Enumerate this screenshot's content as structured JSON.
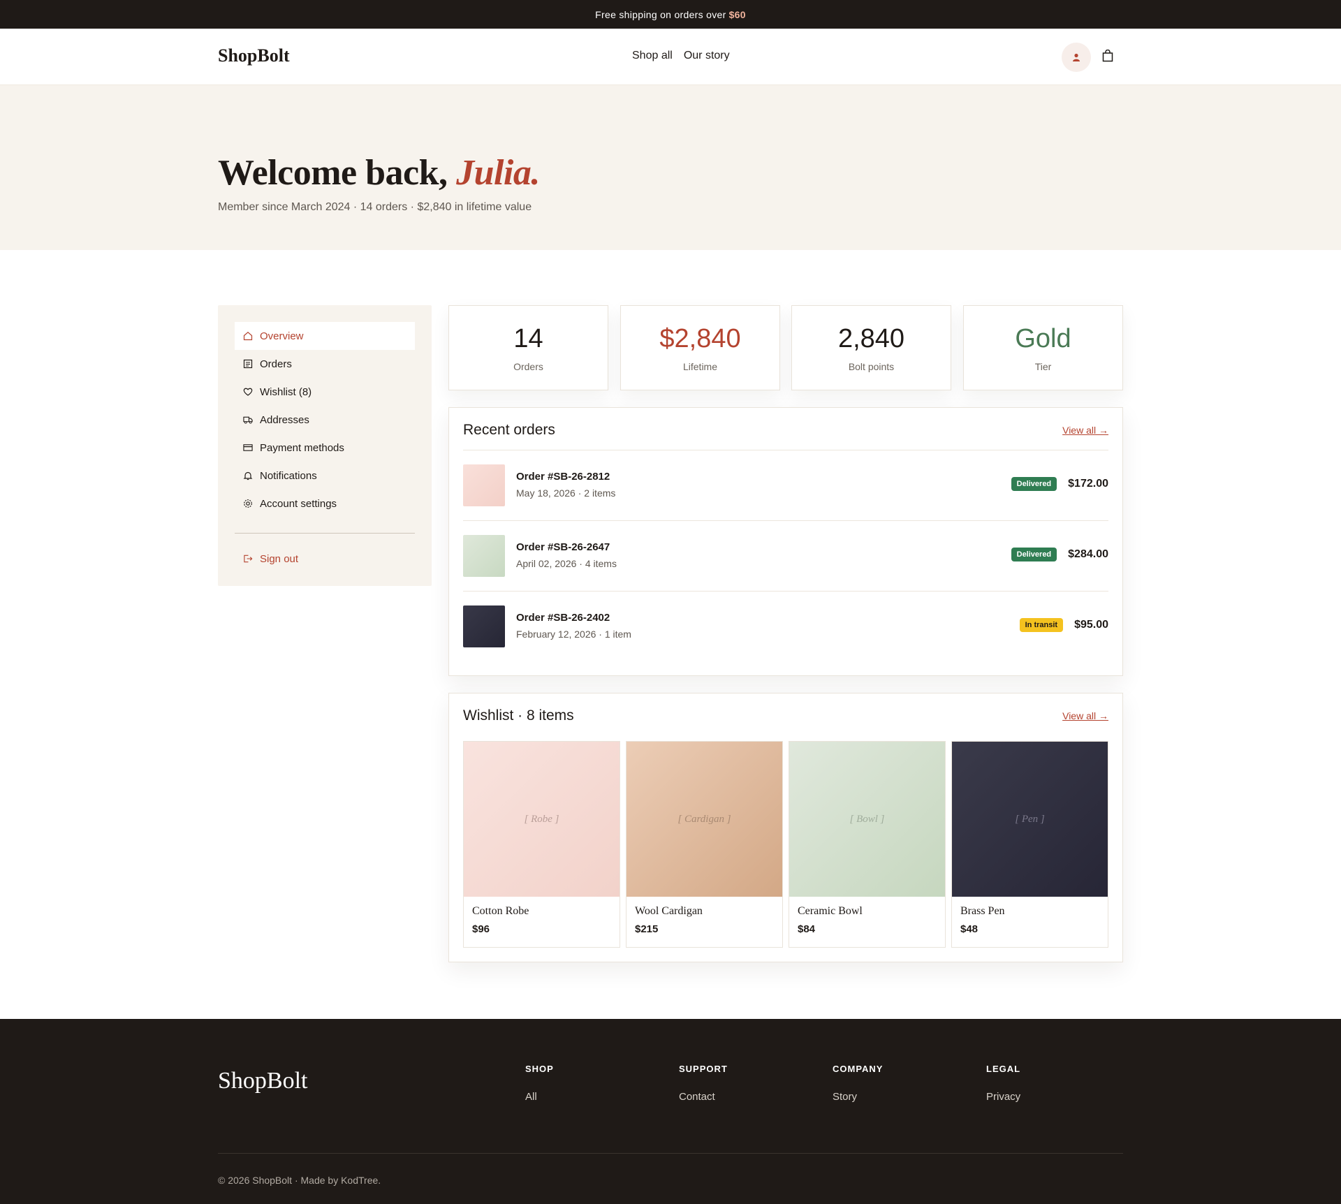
{
  "announcement": {
    "text": "Free shipping on orders over",
    "amount": "$60"
  },
  "header": {
    "logo": "ShopBolt",
    "nav": [
      "Shop all",
      "Our story"
    ],
    "icons": {
      "account": "user-icon",
      "bag": "shopping-bag-icon"
    }
  },
  "hero": {
    "greeting": "Welcome back,",
    "name": "Julia.",
    "subtitle": "Member since March 2024 · 14 orders · $2,840 in lifetime value"
  },
  "sidebar": {
    "items": [
      {
        "label": "Overview",
        "icon": "home-icon"
      },
      {
        "label": "Orders",
        "icon": "receipt-icon"
      },
      {
        "label": "Wishlist (8)",
        "icon": "heart-icon"
      },
      {
        "label": "Addresses",
        "icon": "truck-icon"
      },
      {
        "label": "Payment methods",
        "icon": "credit-card-icon"
      },
      {
        "label": "Notifications",
        "icon": "bell-icon"
      },
      {
        "label": "Account settings",
        "icon": "gear-icon"
      }
    ],
    "signout": "Sign out"
  },
  "stats": [
    {
      "value": "14",
      "label": "Orders",
      "color": "#1f1a17"
    },
    {
      "value": "$2,840",
      "label": "Lifetime",
      "color": "#b4432f"
    },
    {
      "value": "2,840",
      "label": "Bolt points",
      "color": "#1f1a17"
    },
    {
      "value": "Gold",
      "label": "Tier",
      "color": "#4a7a55"
    }
  ],
  "recent_orders": {
    "title": "Recent orders",
    "view_all": "View all →",
    "rows": [
      {
        "id": "Order #SB-26-2812",
        "meta": "May 18, 2026 · 2 items",
        "status": "Delivered",
        "price": "$172.00"
      },
      {
        "id": "Order #SB-26-2647",
        "meta": "April 02, 2026 · 4 items",
        "status": "Delivered",
        "price": "$284.00"
      },
      {
        "id": "Order #SB-26-2402",
        "meta": "February 12, 2026 · 1 item",
        "status": "In transit",
        "price": "$95.00"
      }
    ]
  },
  "wishlist": {
    "title": "Wishlist · 8 items",
    "view_all": "View all →",
    "items": [
      {
        "placeholder": "[ Robe ]",
        "name": "Cotton Robe",
        "price": "$96"
      },
      {
        "placeholder": "[ Cardigan ]",
        "name": "Wool Cardigan",
        "price": "$215"
      },
      {
        "placeholder": "[ Bowl ]",
        "name": "Ceramic Bowl",
        "price": "$84"
      },
      {
        "placeholder": "[ Pen ]",
        "name": "Brass Pen",
        "price": "$48"
      }
    ]
  },
  "footer": {
    "logo": "ShopBolt",
    "columns": [
      {
        "heading": "SHOP",
        "link": "All"
      },
      {
        "heading": "SUPPORT",
        "link": "Contact"
      },
      {
        "heading": "COMPANY",
        "link": "Story"
      },
      {
        "heading": "LEGAL",
        "link": "Privacy"
      }
    ],
    "copyright": "© 2026 ShopBolt · Made by KodTree."
  },
  "colors": {
    "accent": "#b4432f",
    "dark": "#1f1a17",
    "cream": "#f7f3ed",
    "delivered": "#2f7d52",
    "transit": "#f4c21f"
  }
}
